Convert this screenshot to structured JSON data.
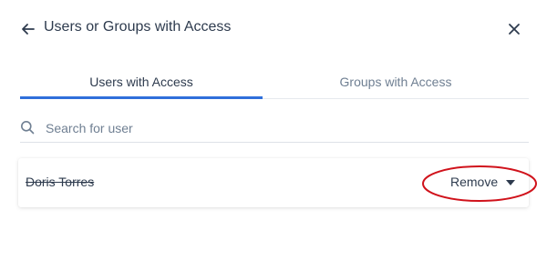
{
  "header": {
    "title": "Users or Groups with Access",
    "back_icon": "arrow-left-icon",
    "close_icon": "close-icon"
  },
  "tabs": [
    {
      "label": "Users with Access",
      "active": true
    },
    {
      "label": "Groups with Access",
      "active": false
    }
  ],
  "search": {
    "placeholder": "Search for user",
    "value": "",
    "icon": "search-icon"
  },
  "users": [
    {
      "name": "Doris Torres",
      "action_label": "Remove",
      "action_icon": "caret-down-icon"
    }
  ],
  "colors": {
    "accent": "#2f6fdb",
    "annotation": "#d0121b",
    "text": "#2e3b4e",
    "muted": "#6f7f92"
  }
}
